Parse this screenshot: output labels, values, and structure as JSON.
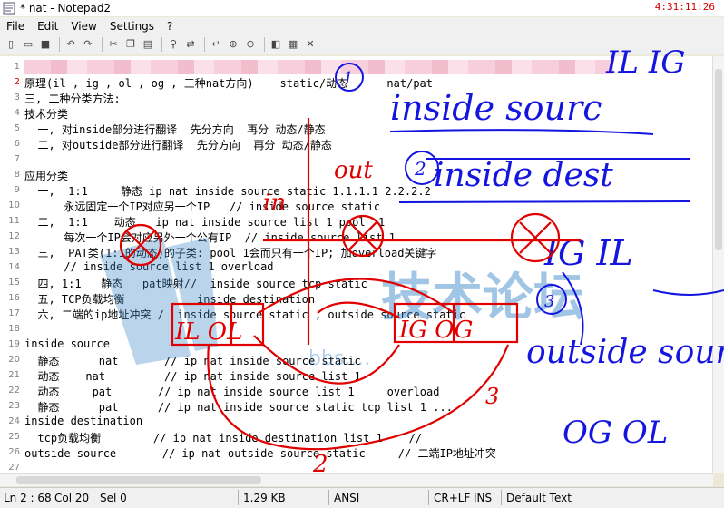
{
  "window": {
    "title": "* nat - Notepad2",
    "clock": "4:31:11:26"
  },
  "menu": [
    "File",
    "Edit",
    "View",
    "Settings",
    "?"
  ],
  "lines": [
    {
      "n": "1",
      "text": ""
    },
    {
      "n": "2",
      "text": "原理(il , ig , ol , og , 三种nat方向)    static/动态      nat/pat"
    },
    {
      "n": "3",
      "text": "三, 二种分类方法:"
    },
    {
      "n": "4",
      "text": "技术分类"
    },
    {
      "n": "5",
      "text": "  一, 对inside部分进行翻译  先分方向  再分 动态/静态"
    },
    {
      "n": "6",
      "text": "  二, 对outside部分进行翻译  先分方向  再分 动态/静态"
    },
    {
      "n": "7",
      "text": ""
    },
    {
      "n": "8",
      "text": "应用分类"
    },
    {
      "n": "9",
      "text": "  一,  1:1     静态 ip nat inside source static 1.1.1.1 2.2.2.2"
    },
    {
      "n": "10",
      "text": "      永远固定一个IP对应另一个IP   // inside source static"
    },
    {
      "n": "11",
      "text": "  二,  1:1    动态   ip nat inside source list 1 pool  1"
    },
    {
      "n": "12",
      "text": "      每次一个IP会对应另外一个公有IP  // inside source list 1"
    },
    {
      "n": "13",
      "text": "  三,  PAT类(1:1的动态)的子类: pool 1会而只有一个IP; 加overload关键字"
    },
    {
      "n": "14",
      "text": "      // inside source list 1 overload"
    },
    {
      "n": "15",
      "text": "  四, 1:1   静态   pat映射//  inside source tcp static"
    },
    {
      "n": "16",
      "text": "  五, TCP负载均衡           inside destination"
    },
    {
      "n": "17",
      "text": "  六, 二端的ip地址冲突 /  inside source static , outside source static"
    },
    {
      "n": "18",
      "text": ""
    },
    {
      "n": "19",
      "text": "inside source"
    },
    {
      "n": "20",
      "text": "  静态      nat       // ip nat inside source static"
    },
    {
      "n": "21",
      "text": "  动态    nat         // ip nat inside source list 1"
    },
    {
      "n": "22",
      "text": "  动态     pat       // ip nat inside source list 1     overload"
    },
    {
      "n": "23",
      "text": "  静态      pat      // ip nat inside source static tcp list 1 ..."
    },
    {
      "n": "24",
      "text": "inside destination"
    },
    {
      "n": "25",
      "text": "  tcp负载均衡        // ip nat inside destination list 1    //"
    },
    {
      "n": "26",
      "text": "outside source       // ip nat outside source static     // 二端IP地址冲突"
    },
    {
      "n": "27",
      "text": ""
    }
  ],
  "status": {
    "position": "Ln 2 : 68",
    "col": "Col 20",
    "sel": "Sel 0",
    "size": "1.29 KB",
    "encoding": "ANSI",
    "eol": "CR+LF",
    "mode": "INS",
    "scheme": "Default Text"
  },
  "annotations": {
    "top_right": "IL IG",
    "inside_source": "inside sourc",
    "circle_1": "1",
    "circle_2": "2",
    "circle_3": "3",
    "inside_dest": "inside dest",
    "out_label": "out",
    "in_label": "in",
    "ig_il": "IG IL",
    "il_ol": "IL  OL",
    "ig_og": "IG  OG",
    "outside_source": "outside sour",
    "og_ol": "OG  OL",
    "num_2": "2",
    "num_3": "3",
    "cross": "×"
  },
  "watermark": {
    "text": "技术论坛",
    "sub": "bbs.…"
  }
}
